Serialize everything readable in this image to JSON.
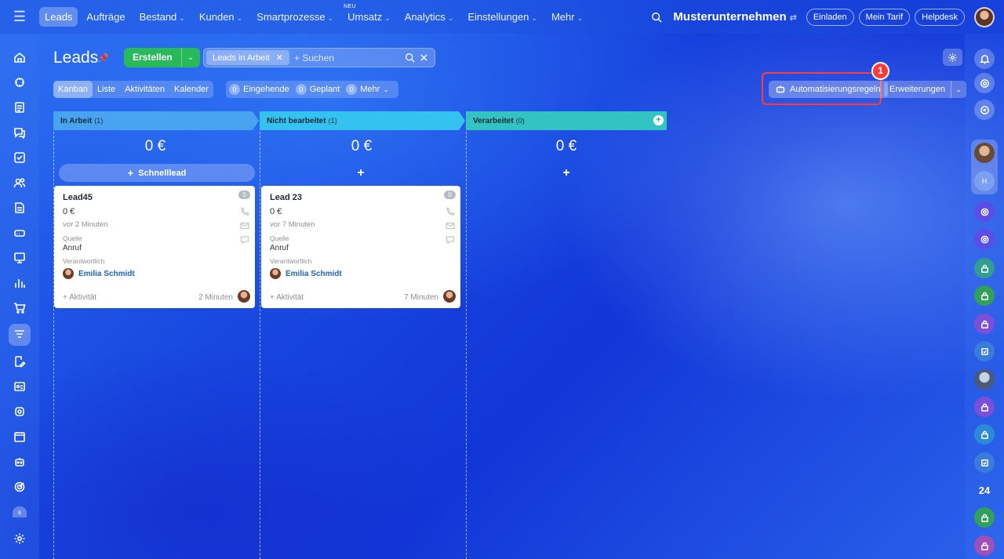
{
  "nav": {
    "items": [
      {
        "label": "Leads",
        "active": true,
        "chevron": false
      },
      {
        "label": "Aufträge",
        "chevron": false
      },
      {
        "label": "Bestand",
        "chevron": true
      },
      {
        "label": "Kunden",
        "chevron": true
      },
      {
        "label": "Smartprozesse",
        "chevron": true
      },
      {
        "label": "Umsatz",
        "chevron": true,
        "badge": "NEU"
      },
      {
        "label": "Analytics",
        "chevron": true
      },
      {
        "label": "Einstellungen",
        "chevron": true
      },
      {
        "label": "Mehr",
        "chevron": true
      }
    ]
  },
  "topright": {
    "company": "Musterunternehmen",
    "invite": "Einladen",
    "plan": "Mein Tarif",
    "helpdesk": "Helpdesk"
  },
  "page": {
    "title": "Leads",
    "create_label": "Erstellen",
    "filter_tag": "Leads in Arbeit",
    "search_placeholder": "+ Suchen"
  },
  "views": [
    "Kanban",
    "Liste",
    "Aktivitäten",
    "Kalender"
  ],
  "counters": [
    {
      "count": "0",
      "label": "Eingehende"
    },
    {
      "count": "0",
      "label": "Geplant"
    },
    {
      "count": "0",
      "label": "Mehr"
    }
  ],
  "actions": {
    "automation": "Automatisierungsregeln",
    "step": "1",
    "extensions": "Erweiterungen"
  },
  "columns": [
    {
      "name": "In Arbeit",
      "count": "(1)",
      "sum": "0 €",
      "color": "#48a4f0",
      "quick": "Schnelllead"
    },
    {
      "name": "Nicht bearbeitet",
      "count": "(1)",
      "sum": "0 €",
      "color": "#34c2f0"
    },
    {
      "name": "Verarbeitet",
      "count": "(0)",
      "sum": "0 €",
      "color": "#33c3c3"
    }
  ],
  "cards": [
    {
      "title": "Lead45",
      "badge": "0",
      "amount": "0 €",
      "ago": "vor 2 Minuten",
      "source_label": "Quelle",
      "source": "Anruf",
      "resp_label": "Verantwortlich",
      "person": "Emilia Schmidt",
      "activity": "+ Aktivität",
      "time": "2 Minuten"
    },
    {
      "title": "Lead 23",
      "badge": "0",
      "amount": "0 €",
      "ago": "vor 7 Minuten",
      "source_label": "Quelle",
      "source": "Anruf",
      "resp_label": "Verantwortlich",
      "person": "Emilia Schmidt",
      "activity": "+ Aktivität",
      "time": "7 Minuten"
    }
  ],
  "rightbar": {
    "number_badge": "24",
    "group_letter": "H"
  },
  "leftbar": {
    "letter": "s"
  }
}
